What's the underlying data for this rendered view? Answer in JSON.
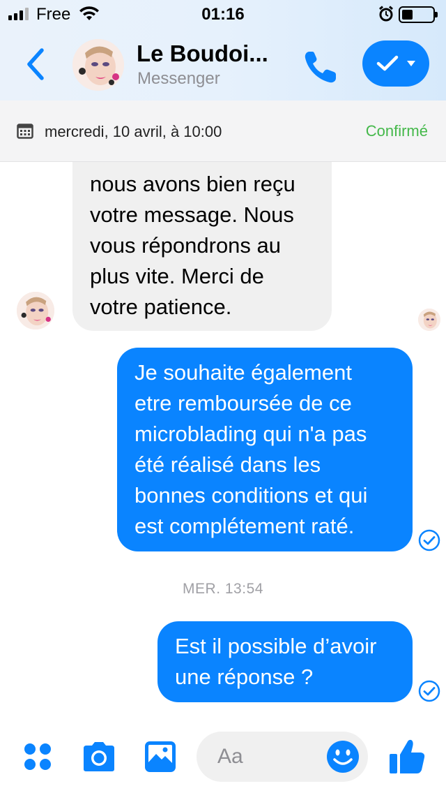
{
  "status_bar": {
    "carrier": "Free",
    "time": "01:16",
    "battery_level": 0.35
  },
  "header": {
    "back_icon": "chevron-left-icon",
    "contact_name": "Le Boudoi...",
    "subtitle": "Messenger",
    "call_icon": "phone-icon",
    "action_icon": "checkmark-dropdown-icon"
  },
  "appointment": {
    "icon": "calendar-icon",
    "date_text": "mercredi, 10 avril, à 10:00",
    "status": "Confirmé"
  },
  "messages": {
    "incoming_1": {
      "lines": [
        "nous avons bien reçu",
        "votre message. Nous",
        "vous répondrons au",
        "plus vite. Merci de",
        "votre patience."
      ]
    },
    "outgoing_1": {
      "lines": [
        "Je souhaite également",
        "etre remboursée de ce",
        "microblading qui n'a pas",
        "été réalisé dans les",
        "bonnes conditions et qui",
        "est complétement raté."
      ]
    },
    "timestamp_1": "MER. 13:54",
    "outgoing_2": {
      "lines": [
        "Est il possible d’avoir",
        "une réponse ?"
      ]
    }
  },
  "composer": {
    "placeholder": "Aa",
    "more_icon": "four-dots-icon",
    "camera_icon": "camera-icon",
    "gallery_icon": "image-icon",
    "emoji_icon": "smiley-icon",
    "like_icon": "thumbs-up-icon"
  },
  "colors": {
    "accent": "#0a84ff",
    "confirmed": "#44b84a",
    "incoming_bubble": "#f0f0f0"
  }
}
